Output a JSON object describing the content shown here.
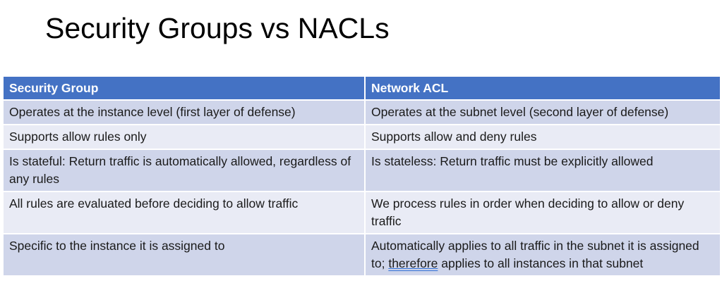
{
  "slide": {
    "title": "Security Groups vs NACLs"
  },
  "table": {
    "headers": [
      "Security Group",
      "Network ACL"
    ],
    "rows": [
      {
        "security_group": "Operates at the instance level (first layer of defense)",
        "network_acl": "Operates at the subnet level (second layer of defense)"
      },
      {
        "security_group": "Supports allow rules only",
        "network_acl": "Supports allow and deny rules"
      },
      {
        "security_group": "Is stateful: Return traffic is automatically allowed, regardless of any rules",
        "network_acl": "Is stateless: Return traffic must be explicitly allowed"
      },
      {
        "security_group": "All rules are evaluated before deciding to allow traffic",
        "network_acl": "We process rules in order when deciding to allow or deny traffic"
      },
      {
        "security_group": "Specific to the instance it is assigned to",
        "network_acl_prefix": "Automatically applies to all traffic in the subnet it is assigned to; ",
        "network_acl_underlined": "therefore",
        "network_acl_suffix": " applies to all instances in that subnet"
      }
    ]
  },
  "colors": {
    "header_bg": "#4472c4",
    "row_odd_bg": "#cfd5ea",
    "row_even_bg": "#e9ebf5"
  }
}
